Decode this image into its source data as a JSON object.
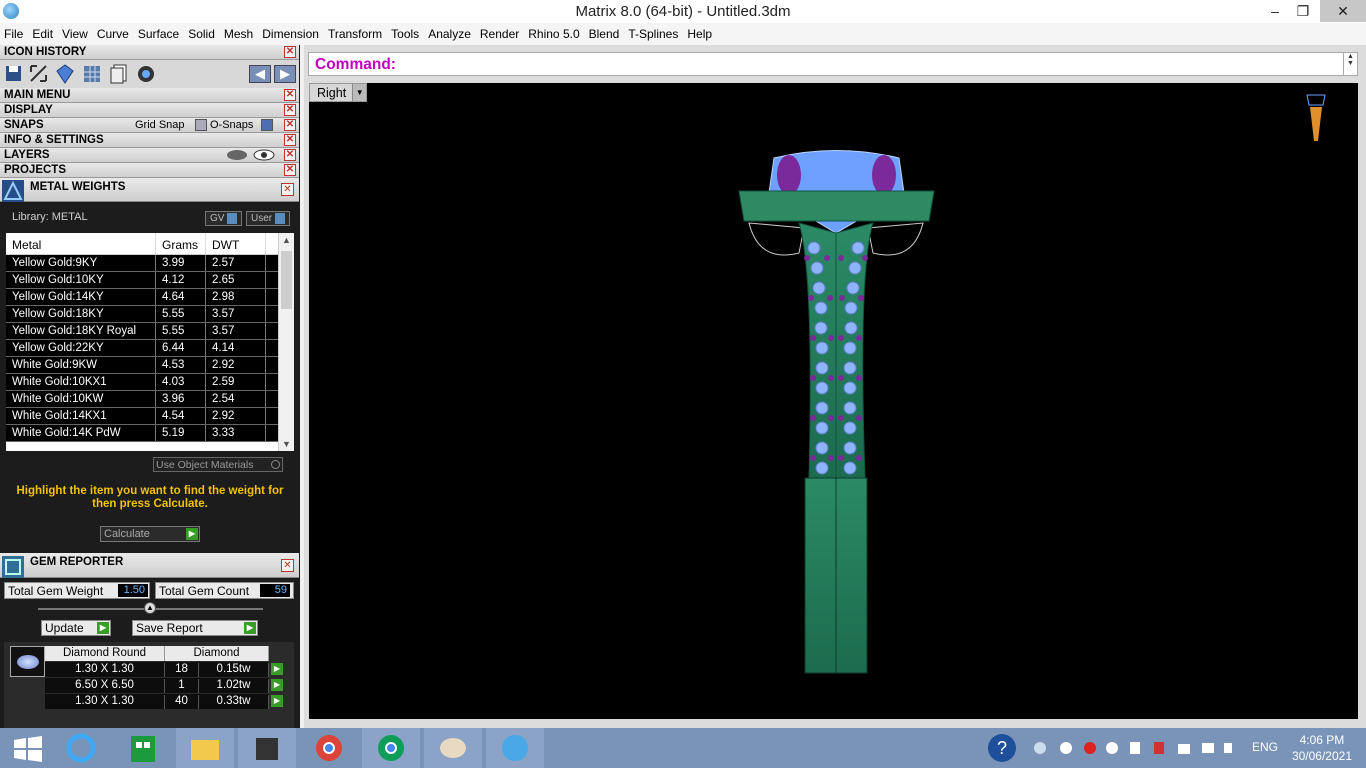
{
  "window": {
    "title": "Matrix 8.0 (64-bit) - Untitled.3dm",
    "minimize": "–",
    "restore": "❐",
    "close": "✕"
  },
  "menu": [
    "File",
    "Edit",
    "View",
    "Curve",
    "Surface",
    "Solid",
    "Mesh",
    "Dimension",
    "Transform",
    "Tools",
    "Analyze",
    "Render",
    "Rhino 5.0",
    "Blend",
    "T-Splines",
    "Help"
  ],
  "panels": {
    "icon_history": "ICON HISTORY",
    "main_menu": "MAIN MENU",
    "display": "DISPLAY",
    "snaps": "SNAPS",
    "grid_snap": "Grid Snap",
    "o_snaps": "O-Snaps",
    "info_settings": "INFO & SETTINGS",
    "layers": "LAYERS",
    "projects": "PROJECTS",
    "close_glyph": "✕"
  },
  "metal_weights": {
    "title": "METAL WEIGHTS",
    "library": "Library: METAL",
    "gv_label": "GV",
    "user_label": "User",
    "columns": [
      "Metal",
      "Grams",
      "DWT"
    ],
    "rows": [
      [
        "Yellow Gold:9KY",
        "3.99",
        "2.57"
      ],
      [
        "Yellow Gold:10KY",
        "4.12",
        "2.65"
      ],
      [
        "Yellow Gold:14KY",
        "4.64",
        "2.98"
      ],
      [
        "Yellow Gold:18KY",
        "5.55",
        "3.57"
      ],
      [
        "Yellow Gold:18KY Royal",
        "5.55",
        "3.57"
      ],
      [
        "Yellow Gold:22KY",
        "6.44",
        "4.14"
      ],
      [
        "White Gold:9KW",
        "4.53",
        "2.92"
      ],
      [
        "White Gold:10KX1",
        "4.03",
        "2.59"
      ],
      [
        "White Gold:10KW",
        "3.96",
        "2.54"
      ],
      [
        "White Gold:14KX1",
        "4.54",
        "2.92"
      ],
      [
        "White Gold:14K PdW",
        "5.19",
        "3.33"
      ]
    ],
    "use_object_materials": "Use Object Materials",
    "hint": "Highlight the item you want to find the weight for then press Calculate.",
    "calculate": "Calculate"
  },
  "gem_reporter": {
    "title": "GEM REPORTER",
    "total_weight_label": "Total Gem Weight",
    "total_weight": "1.50",
    "total_count_label": "Total Gem Count",
    "total_count": "59",
    "update": "Update",
    "save_report": "Save Report",
    "headers": [
      "Diamond Round",
      "Diamond"
    ],
    "rows": [
      [
        "1.30 X 1.30",
        "18",
        "0.15tw"
      ],
      [
        "6.50 X 6.50",
        "1",
        "1.02tw"
      ],
      [
        "1.30 X 1.30",
        "40",
        "0.33tw"
      ]
    ]
  },
  "command": {
    "label": "Command:"
  },
  "viewport": {
    "name": "Right"
  },
  "taskbar": {
    "lang": "ENG",
    "time": "4:06 PM",
    "date": "30/06/2021"
  },
  "colors": {
    "command": "#c000c0",
    "hint": "#f2c200",
    "metal": "#2e8a63",
    "gem_light": "#8fb4ff",
    "gem_purple": "#7a2a9a"
  }
}
